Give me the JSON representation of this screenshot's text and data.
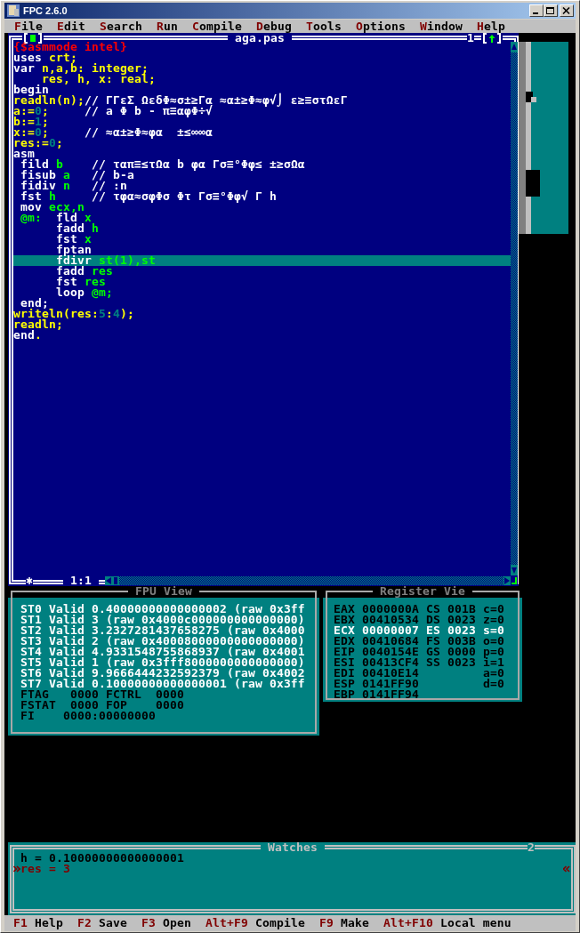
{
  "window": {
    "title": "FPC 2.6.0"
  },
  "menu": [
    {
      "hotkey": "F",
      "rest": "ile"
    },
    {
      "hotkey": "E",
      "rest": "dit"
    },
    {
      "hotkey": "S",
      "rest": "earch"
    },
    {
      "hotkey": "R",
      "rest": "un"
    },
    {
      "hotkey": "C",
      "rest": "ompile"
    },
    {
      "hotkey": "D",
      "rest": "ebug"
    },
    {
      "hotkey": "T",
      "rest": "ools"
    },
    {
      "hotkey": "O",
      "rest": "ptions"
    },
    {
      "hotkey": "W",
      "rest": "indow"
    },
    {
      "hotkey": "H",
      "rest": "elp"
    }
  ],
  "editor": {
    "title": "aga.pas",
    "window_number": "1",
    "cursor": "1:1",
    "modified": true,
    "lines": [
      {
        "current": false,
        "tokens": [
          {
            "kind": "directive",
            "text": "{$asmmode intel}"
          }
        ]
      },
      {
        "current": false,
        "tokens": [
          {
            "kind": "keyword",
            "text": "uses "
          },
          {
            "kind": "identifier",
            "text": "crt;"
          }
        ]
      },
      {
        "current": false,
        "tokens": [
          {
            "kind": "keyword",
            "text": "var "
          },
          {
            "kind": "identifier",
            "text": "n,a,b: integer;"
          }
        ]
      },
      {
        "current": false,
        "tokens": [
          {
            "kind": "identifier",
            "text": "    res, h, x: real;"
          }
        ]
      },
      {
        "current": false,
        "tokens": [
          {
            "kind": "keyword",
            "text": "begin"
          }
        ]
      },
      {
        "current": false,
        "tokens": [
          {
            "kind": "identifier",
            "text": "readln(n);"
          },
          {
            "kind": "comment",
            "text": "// ΓΓεΣ ΩεδΦ≈σ±≥Γα ≈α±≥Φ≈φ√⌡ ε≥≡στΩεΓ"
          }
        ]
      },
      {
        "current": false,
        "tokens": [
          {
            "kind": "identifier",
            "text": "a:="
          },
          {
            "kind": "number",
            "text": "0"
          },
          {
            "kind": "identifier",
            "text": ";"
          },
          {
            "kind": "comment",
            "text": "     // a Φ b - π≡αφΦ÷√"
          }
        ]
      },
      {
        "current": false,
        "tokens": [
          {
            "kind": "identifier",
            "text": "b:="
          },
          {
            "kind": "number",
            "text": "1"
          },
          {
            "kind": "identifier",
            "text": ";"
          }
        ]
      },
      {
        "current": false,
        "tokens": [
          {
            "kind": "identifier",
            "text": "x:="
          },
          {
            "kind": "number",
            "text": "0"
          },
          {
            "kind": "identifier",
            "text": ";"
          },
          {
            "kind": "comment",
            "text": "     // ≈α±≥Φ≈φα  ±≤∞∞α"
          }
        ]
      },
      {
        "current": false,
        "tokens": [
          {
            "kind": "identifier",
            "text": "res:="
          },
          {
            "kind": "number",
            "text": "0"
          },
          {
            "kind": "identifier",
            "text": ";"
          }
        ]
      },
      {
        "current": false,
        "tokens": [
          {
            "kind": "keyword",
            "text": "asm"
          }
        ]
      },
      {
        "current": false,
        "tokens": [
          {
            "kind": "keyword",
            "text": " fild "
          },
          {
            "kind": "operand",
            "text": "b"
          },
          {
            "kind": "comment",
            "text": "    // ταπ≡≤τΩα b φα Γσ≡°Φφ≤ ±≥σΩα"
          }
        ]
      },
      {
        "current": false,
        "tokens": [
          {
            "kind": "keyword",
            "text": " fisub "
          },
          {
            "kind": "operand",
            "text": "a"
          },
          {
            "kind": "comment",
            "text": "   // b-a"
          }
        ]
      },
      {
        "current": false,
        "tokens": [
          {
            "kind": "keyword",
            "text": " fidiv "
          },
          {
            "kind": "operand",
            "text": "n"
          },
          {
            "kind": "comment",
            "text": "   // :n"
          }
        ]
      },
      {
        "current": false,
        "tokens": [
          {
            "kind": "keyword",
            "text": " fst "
          },
          {
            "kind": "operand",
            "text": "h"
          },
          {
            "kind": "comment",
            "text": "     // τφα≈σφΦσ Φτ Γσ≡°Φφ√ Γ h"
          }
        ]
      },
      {
        "current": false,
        "tokens": [
          {
            "kind": "keyword",
            "text": " mov "
          },
          {
            "kind": "operand",
            "text": "ecx,n"
          }
        ]
      },
      {
        "current": false,
        "tokens": [
          {
            "kind": "operand",
            "text": " @m:"
          },
          {
            "kind": "keyword",
            "text": "  fld "
          },
          {
            "kind": "operand",
            "text": "x"
          }
        ]
      },
      {
        "current": false,
        "tokens": [
          {
            "kind": "keyword",
            "text": "      fadd "
          },
          {
            "kind": "operand",
            "text": "h"
          }
        ]
      },
      {
        "current": false,
        "tokens": [
          {
            "kind": "keyword",
            "text": "      fst "
          },
          {
            "kind": "operand",
            "text": "x"
          }
        ]
      },
      {
        "current": false,
        "tokens": [
          {
            "kind": "keyword",
            "text": "      fptan"
          }
        ]
      },
      {
        "current": true,
        "tokens": [
          {
            "kind": "keyword",
            "text": "      fdivr "
          },
          {
            "kind": "operand",
            "text": "st(1),st"
          }
        ]
      },
      {
        "current": false,
        "tokens": [
          {
            "kind": "keyword",
            "text": "      fadd "
          },
          {
            "kind": "operand",
            "text": "res"
          }
        ]
      },
      {
        "current": false,
        "tokens": [
          {
            "kind": "keyword",
            "text": "      fst "
          },
          {
            "kind": "operand",
            "text": "res"
          }
        ]
      },
      {
        "current": false,
        "tokens": [
          {
            "kind": "keyword",
            "text": "      loop "
          },
          {
            "kind": "operand",
            "text": "@m;"
          }
        ]
      },
      {
        "current": false,
        "tokens": [
          {
            "kind": "keyword",
            "text": " end;"
          }
        ]
      },
      {
        "current": false,
        "tokens": [
          {
            "kind": "identifier",
            "text": "writeln(res:"
          },
          {
            "kind": "number",
            "text": "5"
          },
          {
            "kind": "identifier",
            "text": ":"
          },
          {
            "kind": "number",
            "text": "4"
          },
          {
            "kind": "identifier",
            "text": ");"
          }
        ]
      },
      {
        "current": false,
        "tokens": [
          {
            "kind": "identifier",
            "text": "readln;"
          }
        ]
      },
      {
        "current": false,
        "tokens": [
          {
            "kind": "keyword",
            "text": "end"
          },
          {
            "kind": "identifier",
            "text": "."
          }
        ]
      }
    ]
  },
  "fpu_view": {
    "title": "FPU View",
    "rows": [
      {
        "text": "ST0 Valid 0.40000000000000002 (raw 0x3ff",
        "changed": true
      },
      {
        "text": "ST1 Valid 3 (raw 0x4000c000000000000000)",
        "changed": true
      },
      {
        "text": "ST2 Valid 3.2327281437658275 (raw 0x4000",
        "changed": true
      },
      {
        "text": "ST3 Valid 2 (raw 0x40008000000000000000)",
        "changed": true
      },
      {
        "text": "ST4 Valid 4.9331548755868937 (raw 0x4001",
        "changed": true
      },
      {
        "text": "ST5 Valid 1 (raw 0x3fff8000000000000000)",
        "changed": true
      },
      {
        "text": "ST6 Valid 9.9666444232592379 (raw 0x4002",
        "changed": true
      },
      {
        "text": "ST7 Valid 0.10000000000000001 (raw 0x3ff",
        "changed": true
      },
      {
        "text": "FTAG   0000 FCTRL  0000",
        "changed": false
      },
      {
        "text": "FSTAT  0000 FOP    0000",
        "changed": false
      },
      {
        "text": "FI    0000:00000000",
        "changed": false
      }
    ]
  },
  "register_view": {
    "title": "Register Vie",
    "rows": [
      {
        "text": "EAX 0000000A CS 001B c=0",
        "changed": false
      },
      {
        "text": "EBX 00410534 DS 0023 z=0",
        "changed": false
      },
      {
        "text": "ECX 00000007 ES 0023 s=0",
        "changed": true
      },
      {
        "text": "EDX 00410684 FS 003B o=0",
        "changed": false
      },
      {
        "text": "EIP 0040154E GS 0000 p=0",
        "changed": false
      },
      {
        "text": "ESI 00413CF4 SS 0023 i=1",
        "changed": false
      },
      {
        "text": "EDI 00410E14         a=0",
        "changed": false
      },
      {
        "text": "ESP 0141FF90         d=0",
        "changed": false
      },
      {
        "text": "EBP 0141FF94",
        "changed": false
      }
    ]
  },
  "watches": {
    "title": "Watches",
    "window_number": "2",
    "rows": [
      {
        "text": "h = 0.10000000000000001",
        "selected": false
      },
      {
        "text": "res = 3",
        "selected": true
      }
    ]
  },
  "status_bar": [
    {
      "key": "F1",
      "label": "Help"
    },
    {
      "key": "F2",
      "label": "Save"
    },
    {
      "key": "F3",
      "label": "Open"
    },
    {
      "key": "Alt+F9",
      "label": "Compile"
    },
    {
      "key": "F9",
      "label": "Make"
    },
    {
      "key": "Alt+F10",
      "label": "Local menu"
    }
  ]
}
